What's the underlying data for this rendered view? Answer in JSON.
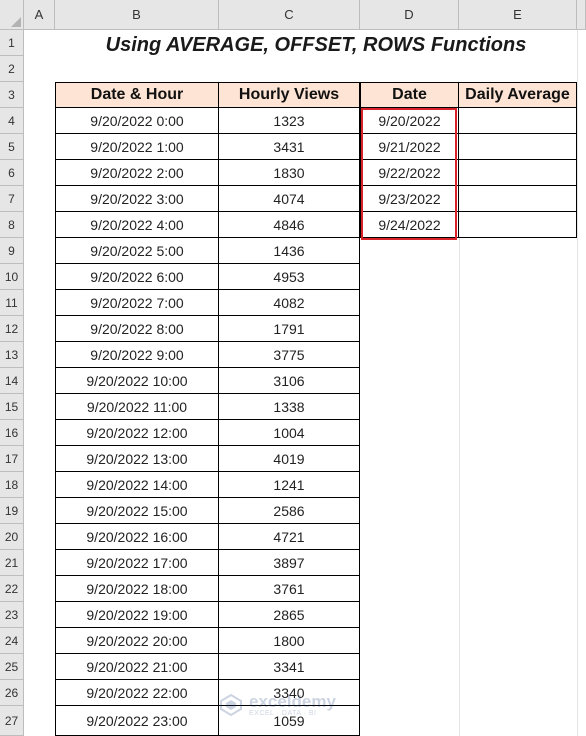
{
  "sheet": {
    "columns": [
      "A",
      "B",
      "C",
      "D",
      "E"
    ],
    "rows": [
      "1",
      "2",
      "3",
      "4",
      "5",
      "6",
      "7",
      "8",
      "9",
      "10",
      "11",
      "12",
      "13",
      "14",
      "15",
      "16",
      "17",
      "18",
      "19",
      "20",
      "21",
      "22",
      "23",
      "24",
      "25",
      "26",
      "27"
    ],
    "title": "Using AVERAGE, OFFSET, ROWS Functions"
  },
  "table_left": {
    "headers": [
      "Date & Hour",
      "Hourly Views"
    ],
    "rows": [
      [
        "9/20/2022 0:00",
        "1323"
      ],
      [
        "9/20/2022 1:00",
        "3431"
      ],
      [
        "9/20/2022 2:00",
        "1830"
      ],
      [
        "9/20/2022 3:00",
        "4074"
      ],
      [
        "9/20/2022 4:00",
        "4846"
      ],
      [
        "9/20/2022 5:00",
        "1436"
      ],
      [
        "9/20/2022 6:00",
        "4953"
      ],
      [
        "9/20/2022 7:00",
        "4082"
      ],
      [
        "9/20/2022 8:00",
        "1791"
      ],
      [
        "9/20/2022 9:00",
        "3775"
      ],
      [
        "9/20/2022 10:00",
        "3106"
      ],
      [
        "9/20/2022 11:00",
        "1338"
      ],
      [
        "9/20/2022 12:00",
        "1004"
      ],
      [
        "9/20/2022 13:00",
        "4019"
      ],
      [
        "9/20/2022 14:00",
        "1241"
      ],
      [
        "9/20/2022 15:00",
        "2586"
      ],
      [
        "9/20/2022 16:00",
        "4721"
      ],
      [
        "9/20/2022 17:00",
        "3897"
      ],
      [
        "9/20/2022 18:00",
        "3761"
      ],
      [
        "9/20/2022 19:00",
        "2865"
      ],
      [
        "9/20/2022 20:00",
        "1800"
      ],
      [
        "9/20/2022 21:00",
        "3341"
      ],
      [
        "9/20/2022 22:00",
        "3340"
      ],
      [
        "9/20/2022 23:00",
        "1059"
      ]
    ]
  },
  "table_right": {
    "headers": [
      "Date",
      "Daily Average"
    ],
    "rows": [
      [
        "9/20/2022",
        ""
      ],
      [
        "9/21/2022",
        ""
      ],
      [
        "9/22/2022",
        ""
      ],
      [
        "9/23/2022",
        ""
      ],
      [
        "9/24/2022",
        ""
      ]
    ]
  },
  "watermark": {
    "name": "exceldemy",
    "tagline": "EXCEL · DATA · BI"
  },
  "colors": {
    "header_fill": "#fde4d4",
    "highlight": "#d9232a",
    "chrome": "#e6e6e6"
  }
}
